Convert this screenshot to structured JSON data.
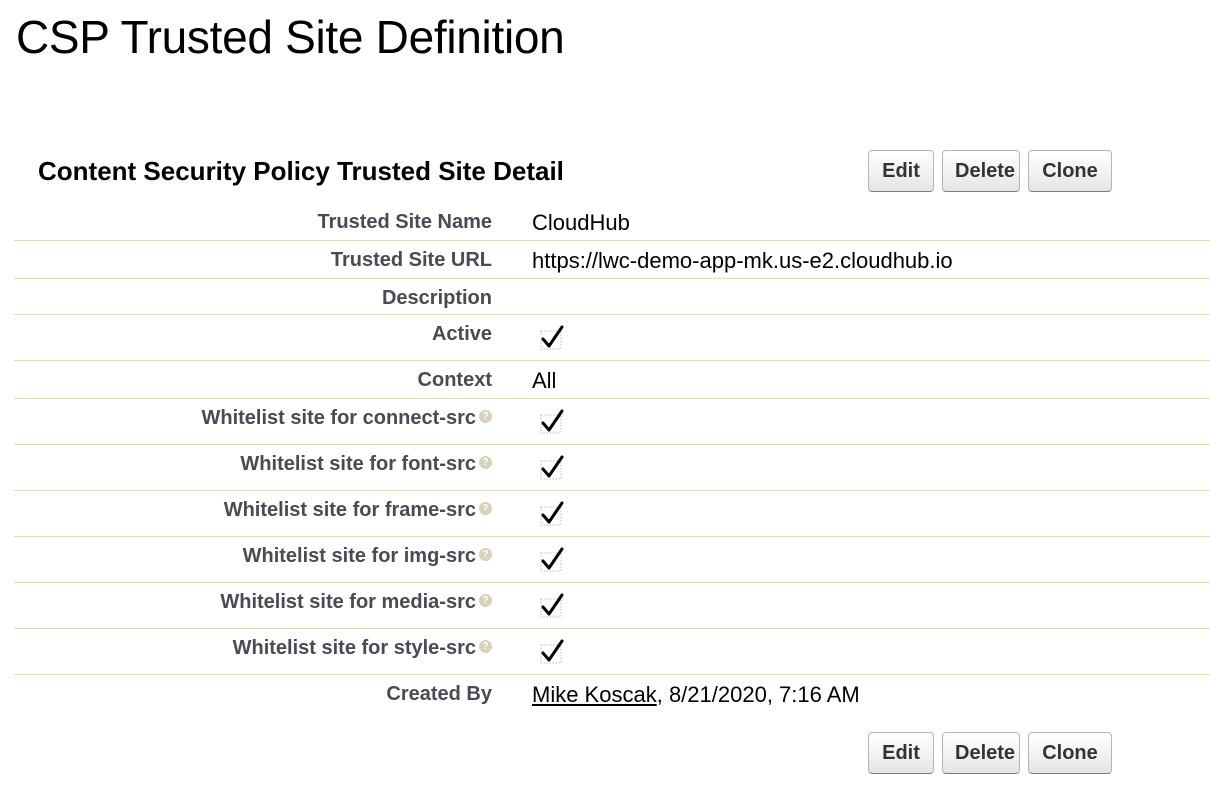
{
  "page": {
    "title": "CSP Trusted Site Definition"
  },
  "detail": {
    "section_title": "Content Security Policy Trusted Site Detail",
    "buttons": {
      "edit": "Edit",
      "delete": "Delete",
      "clone": "Clone"
    },
    "fields": {
      "trusted_site_name": {
        "label": "Trusted Site Name",
        "value": "CloudHub"
      },
      "trusted_site_url": {
        "label": "Trusted Site URL",
        "value": "https://lwc-demo-app-mk.us-e2.cloudhub.io"
      },
      "description": {
        "label": "Description",
        "value": ""
      },
      "active": {
        "label": "Active",
        "checked": true
      },
      "context": {
        "label": "Context",
        "value": "All"
      },
      "connect_src": {
        "label": "Whitelist site for connect-src",
        "checked": true
      },
      "font_src": {
        "label": "Whitelist site for font-src",
        "checked": true
      },
      "frame_src": {
        "label": "Whitelist site for frame-src",
        "checked": true
      },
      "img_src": {
        "label": "Whitelist site for img-src",
        "checked": true
      },
      "media_src": {
        "label": "Whitelist site for media-src",
        "checked": true
      },
      "style_src": {
        "label": "Whitelist site for style-src",
        "checked": true
      },
      "created_by": {
        "label": "Created By",
        "user": "Mike Koscak",
        "timestamp": ", 8/21/2020, 7:16 AM"
      }
    },
    "icons": {
      "help": "help-icon",
      "checkbox": "checkbox-checked-icon"
    },
    "colors": {
      "label_text": "#4a4a56",
      "row_divider": "#e3deb8",
      "help_icon": "#d8d2b8"
    }
  }
}
